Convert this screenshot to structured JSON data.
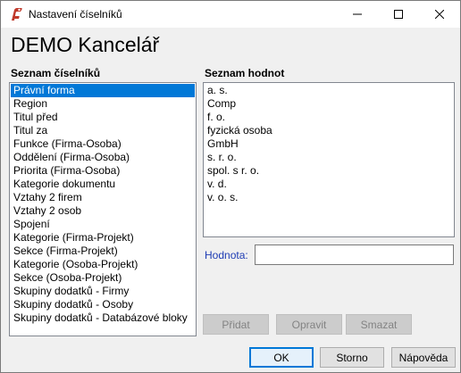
{
  "window": {
    "title": "Nastavení číselníků",
    "heading": "DEMO Kancelář"
  },
  "codebooks": {
    "label": "Seznam číselníků",
    "selected_index": 0,
    "items": [
      "Právní forma",
      "Region",
      "Titul před",
      "Titul za",
      "Funkce (Firma-Osoba)",
      "Oddělení (Firma-Osoba)",
      "Priorita (Firma-Osoba)",
      "Kategorie dokumentu",
      "Vztahy 2 firem",
      "Vztahy 2 osob",
      "Spojení",
      "Kategorie (Firma-Projekt)",
      "Sekce (Firma-Projekt)",
      "Kategorie (Osoba-Projekt)",
      "Sekce (Osoba-Projekt)",
      "Skupiny dodatků - Firmy",
      "Skupiny dodatků - Osoby",
      "Skupiny dodatků - Databázové bloky"
    ]
  },
  "values": {
    "label": "Seznam hodnot",
    "items": [
      "a. s.",
      "Comp",
      "f. o.",
      "fyzická osoba",
      "GmbH",
      "s. r. o.",
      "spol. s r. o.",
      "v. d.",
      "v. o. s."
    ]
  },
  "editor": {
    "label": "Hodnota:",
    "value": "",
    "add_label": "Přidat",
    "edit_label": "Opravit",
    "delete_label": "Smazat"
  },
  "footer": {
    "ok_label": "OK",
    "cancel_label": "Storno",
    "help_label": "Nápověda"
  },
  "colors": {
    "selection": "#0078d7",
    "link_label": "#1e3cb4",
    "app_icon": "#c0392b"
  },
  "icons": {
    "app": "app-logo-icon",
    "minimize": "minimize-icon",
    "maximize": "maximize-icon",
    "close": "close-icon"
  }
}
